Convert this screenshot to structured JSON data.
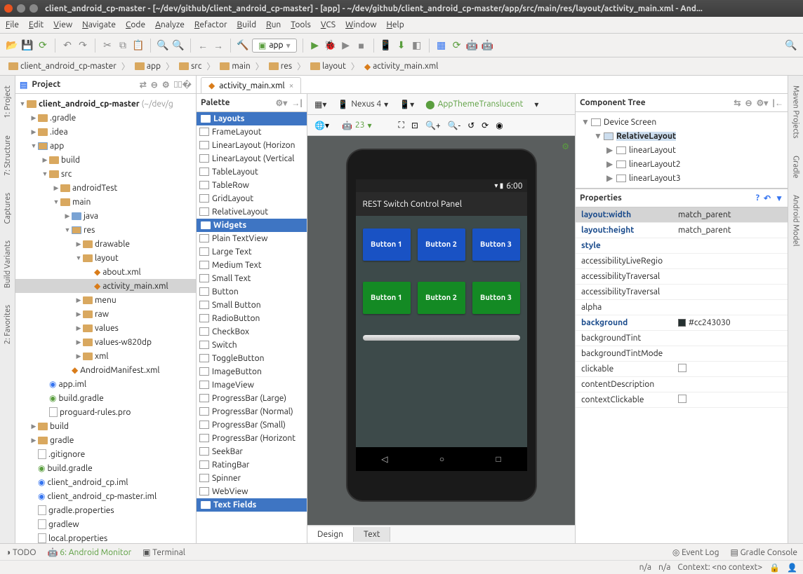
{
  "window": {
    "title": "client_android_cp-master - [~/dev/github/client_android_cp-master] - [app] - ~/dev/github/client_android_cp-master/app/src/main/res/layout/activity_main.xml - And..."
  },
  "menu": [
    "File",
    "Edit",
    "View",
    "Navigate",
    "Code",
    "Analyze",
    "Refactor",
    "Build",
    "Run",
    "Tools",
    "VCS",
    "Window",
    "Help"
  ],
  "toolbar": {
    "app_label": "app"
  },
  "breadcrumb": [
    "client_android_cp-master",
    "app",
    "src",
    "main",
    "res",
    "layout",
    "activity_main.xml"
  ],
  "left_tabs": [
    "1: Project",
    "7: Structure",
    "Captures"
  ],
  "left_tabs2": [
    "Build Variants",
    "2: Favorites"
  ],
  "right_tabs": [
    "Maven Projects",
    "Gradle"
  ],
  "right_tabs2": [
    "Android Model"
  ],
  "project": {
    "header": "Project",
    "root": "client_android_cp-master",
    "root_hint": "(~/dev/g",
    "nodes": [
      {
        "l": 1,
        "t": "f",
        "n": ".gradle",
        "tw": "▶"
      },
      {
        "l": 1,
        "t": "f",
        "n": ".idea",
        "tw": "▶"
      },
      {
        "l": 1,
        "t": "mf",
        "n": "app",
        "tw": "▼"
      },
      {
        "l": 2,
        "t": "f",
        "n": "build",
        "tw": "▶"
      },
      {
        "l": 2,
        "t": "f",
        "n": "src",
        "tw": "▼"
      },
      {
        "l": 3,
        "t": "f",
        "n": "androidTest",
        "tw": "▶"
      },
      {
        "l": 3,
        "t": "f",
        "n": "main",
        "tw": "▼"
      },
      {
        "l": 4,
        "t": "bf",
        "n": "java",
        "tw": "▶"
      },
      {
        "l": 4,
        "t": "mf",
        "n": "res",
        "tw": "▼"
      },
      {
        "l": 5,
        "t": "f",
        "n": "drawable",
        "tw": "▶"
      },
      {
        "l": 5,
        "t": "f",
        "n": "layout",
        "tw": "▼"
      },
      {
        "l": 6,
        "t": "xml",
        "n": "about.xml",
        "tw": ""
      },
      {
        "l": 6,
        "t": "xml",
        "n": "activity_main.xml",
        "tw": "",
        "sel": true
      },
      {
        "l": 5,
        "t": "f",
        "n": "menu",
        "tw": "▶"
      },
      {
        "l": 5,
        "t": "f",
        "n": "raw",
        "tw": "▶"
      },
      {
        "l": 5,
        "t": "f",
        "n": "values",
        "tw": "▶"
      },
      {
        "l": 5,
        "t": "f",
        "n": "values-w820dp",
        "tw": "▶"
      },
      {
        "l": 5,
        "t": "f",
        "n": "xml",
        "tw": "▶"
      },
      {
        "l": 4,
        "t": "xml",
        "n": "AndroidManifest.xml",
        "tw": ""
      },
      {
        "l": 2,
        "t": "i",
        "n": "app.iml",
        "tw": ""
      },
      {
        "l": 2,
        "t": "g",
        "n": "build.gradle",
        "tw": ""
      },
      {
        "l": 2,
        "t": "fl",
        "n": "proguard-rules.pro",
        "tw": ""
      },
      {
        "l": 1,
        "t": "f",
        "n": "build",
        "tw": "▶"
      },
      {
        "l": 1,
        "t": "f",
        "n": "gradle",
        "tw": "▶"
      },
      {
        "l": 1,
        "t": "fl",
        "n": ".gitignore",
        "tw": ""
      },
      {
        "l": 1,
        "t": "g",
        "n": "build.gradle",
        "tw": ""
      },
      {
        "l": 1,
        "t": "i",
        "n": "client_android_cp.iml",
        "tw": ""
      },
      {
        "l": 1,
        "t": "i",
        "n": "client_android_cp-master.iml",
        "tw": ""
      },
      {
        "l": 1,
        "t": "fl",
        "n": "gradle.properties",
        "tw": ""
      },
      {
        "l": 1,
        "t": "fl",
        "n": "gradlew",
        "tw": ""
      },
      {
        "l": 1,
        "t": "fl",
        "n": "local.properties",
        "tw": ""
      }
    ]
  },
  "editor_tab": "activity_main.xml",
  "palette": {
    "header": "Palette",
    "cats": [
      {
        "name": "Layouts",
        "items": [
          "FrameLayout",
          "LinearLayout (Horizon",
          "LinearLayout (Vertical",
          "TableLayout",
          "TableRow",
          "GridLayout",
          "RelativeLayout"
        ]
      },
      {
        "name": "Widgets",
        "items": [
          "Plain TextView",
          "Large Text",
          "Medium Text",
          "Small Text",
          "Button",
          "Small Button",
          "RadioButton",
          "CheckBox",
          "Switch",
          "ToggleButton",
          "ImageButton",
          "ImageView",
          "ProgressBar (Large)",
          "ProgressBar (Normal)",
          "ProgressBar (Small)",
          "ProgressBar (Horizont",
          "SeekBar",
          "RatingBar",
          "Spinner",
          "WebView"
        ]
      },
      {
        "name": "Text Fields",
        "items": []
      }
    ]
  },
  "canvas": {
    "device": "Nexus 4",
    "theme": "AppThemeTranslucent",
    "api": "23",
    "status_time": "6:00",
    "app_title": "REST Switch Control Panel",
    "btns": [
      "Button 1",
      "Button 2",
      "Button 3"
    ],
    "footer": [
      "Design",
      "Text"
    ]
  },
  "comptree": {
    "header": "Component Tree",
    "rows": [
      {
        "l": 0,
        "n": "Device Screen",
        "tw": "▼"
      },
      {
        "l": 1,
        "n": "RelativeLayout",
        "tw": "▼",
        "hl": true
      },
      {
        "l": 2,
        "n": "linearLayout",
        "tw": "▶"
      },
      {
        "l": 2,
        "n": "linearLayout2",
        "tw": "▶"
      },
      {
        "l": 2,
        "n": "linearLayout3",
        "tw": "▶"
      }
    ]
  },
  "props": {
    "header": "Properties",
    "rows": [
      {
        "k": "layout:width",
        "v": "match_parent",
        "b": true,
        "sel": true
      },
      {
        "k": "layout:height",
        "v": "match_parent",
        "b": true
      },
      {
        "k": "style",
        "v": "",
        "b": true
      },
      {
        "k": "accessibilityLiveRegio",
        "v": ""
      },
      {
        "k": "accessibilityTraversal",
        "v": ""
      },
      {
        "k": "accessibilityTraversal",
        "v": ""
      },
      {
        "k": "alpha",
        "v": ""
      },
      {
        "k": "background",
        "v": "#cc243030",
        "b": true,
        "sw": "#243030"
      },
      {
        "k": "backgroundTint",
        "v": ""
      },
      {
        "k": "backgroundTintMode",
        "v": ""
      },
      {
        "k": "clickable",
        "v": "",
        "cb": true
      },
      {
        "k": "contentDescription",
        "v": ""
      },
      {
        "k": "contextClickable",
        "v": "",
        "cb": true
      }
    ]
  },
  "status": {
    "todo": "TODO",
    "monitor": "6: Android Monitor",
    "terminal": "Terminal",
    "eventlog": "Event Log",
    "gradlec": "Gradle Console",
    "right": [
      "n/a",
      "n/a",
      "Context: <no context>"
    ]
  }
}
